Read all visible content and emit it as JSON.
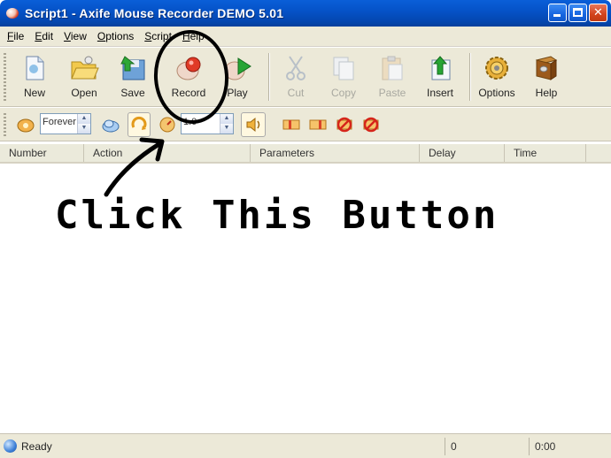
{
  "window": {
    "title": "Script1 - Axife Mouse Recorder DEMO 5.01"
  },
  "menu": [
    {
      "key": "F",
      "rest": "ile"
    },
    {
      "key": "E",
      "rest": "dit"
    },
    {
      "key": "V",
      "rest": "iew"
    },
    {
      "key": "O",
      "rest": "ptions"
    },
    {
      "key": "S",
      "rest": "cript"
    },
    {
      "key": "H",
      "rest": "elp"
    }
  ],
  "toolbar": {
    "new": "New",
    "open": "Open",
    "save": "Save",
    "record": "Record",
    "play": "Play",
    "cut": "Cut",
    "copy": "Copy",
    "paste": "Paste",
    "insert": "Insert",
    "options": "Options",
    "help": "Help"
  },
  "toolbar2": {
    "repeat_value": "Forever",
    "speed_value": "1.0"
  },
  "columns": [
    "Number",
    "Action",
    "Parameters",
    "Delay",
    "Time"
  ],
  "annotation": {
    "text": "Click This Button"
  },
  "status": {
    "text": "Ready",
    "count": "0",
    "time": "0:00"
  }
}
